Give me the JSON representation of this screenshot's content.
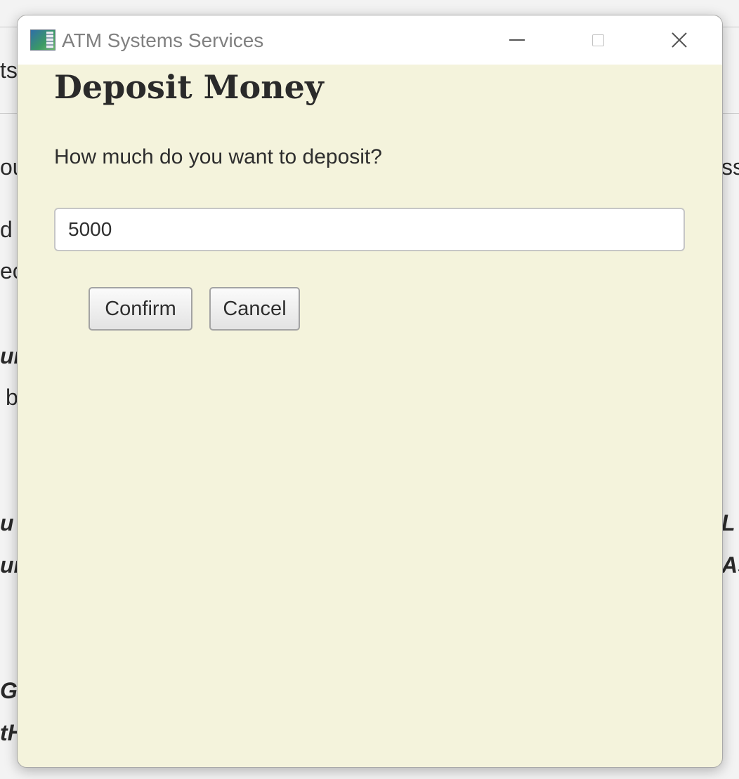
{
  "background": {
    "fragments_left": [
      "ts",
      "ou",
      "d",
      "ec",
      "ur",
      "b",
      "u",
      "ur",
      "Gi",
      "tH"
    ],
    "fragments_right": [
      "ss",
      "L",
      "As"
    ]
  },
  "window": {
    "title": "ATM Systems Services",
    "icon": "app-icon",
    "controls": {
      "minimize_icon": "minimize-icon",
      "maximize_icon": "maximize-icon",
      "close_icon": "close-icon"
    }
  },
  "dialog": {
    "heading": "Deposit Money",
    "prompt": "How much do you want to deposit?",
    "amount_value": "5000",
    "confirm_label": "Confirm",
    "cancel_label": "Cancel"
  },
  "colors": {
    "dialog_background": "#f4f3dc",
    "titlebar_background": "#ffffff",
    "title_text": "#808080"
  }
}
